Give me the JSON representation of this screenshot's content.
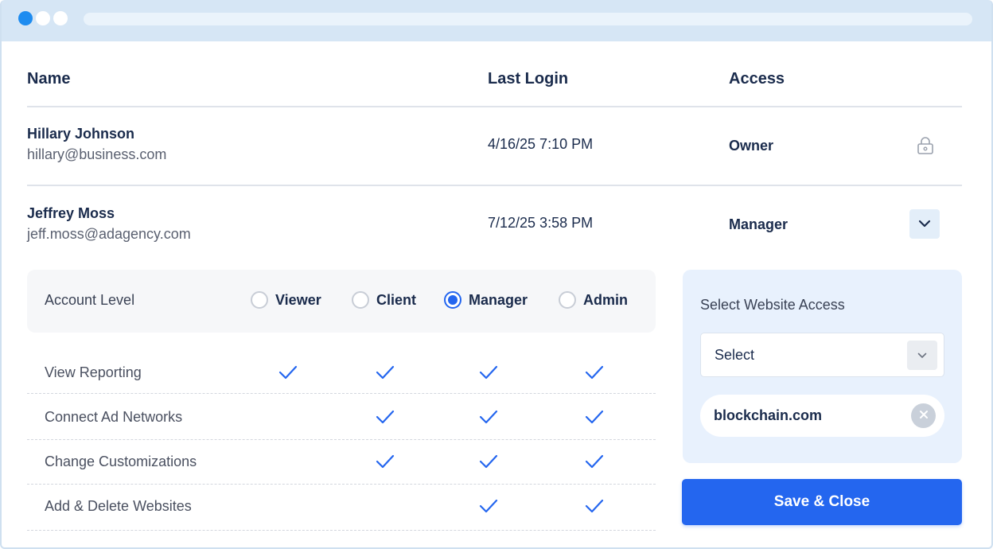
{
  "table": {
    "headers": {
      "name": "Name",
      "last_login": "Last Login",
      "access": "Access"
    },
    "users": [
      {
        "name": "Hillary Johnson",
        "email": "hillary@business.com",
        "last_login": "4/16/25 7:10 PM",
        "role": "Owner",
        "action_icon": "lock-icon"
      },
      {
        "name": "Jeffrey Moss",
        "email": "jeff.moss@adagency.com",
        "last_login": "7/12/25 3:58 PM",
        "role": "Manager",
        "action_icon": "chevron-down-icon"
      }
    ]
  },
  "account_level": {
    "label": "Account Level",
    "options": [
      "Viewer",
      "Client",
      "Manager",
      "Admin"
    ],
    "selected": "Manager"
  },
  "permissions": [
    {
      "label": "View Reporting",
      "viewer": true,
      "client": true,
      "manager": true,
      "admin": true
    },
    {
      "label": "Connect Ad Networks",
      "viewer": false,
      "client": true,
      "manager": true,
      "admin": true
    },
    {
      "label": "Change Customizations",
      "viewer": false,
      "client": true,
      "manager": true,
      "admin": true
    },
    {
      "label": "Add & Delete Websites",
      "viewer": false,
      "client": false,
      "manager": true,
      "admin": true
    }
  ],
  "website_access": {
    "title": "Select Website Access",
    "select_value": "Select",
    "selected_sites": [
      "blockchain.com"
    ]
  },
  "save_button": {
    "label": "Save & Close"
  },
  "colors": {
    "accent": "#2466ef",
    "window_chrome": "#d6e6f5",
    "panel_bg": "#e8f1fd",
    "text_primary": "#1a2b4c"
  }
}
